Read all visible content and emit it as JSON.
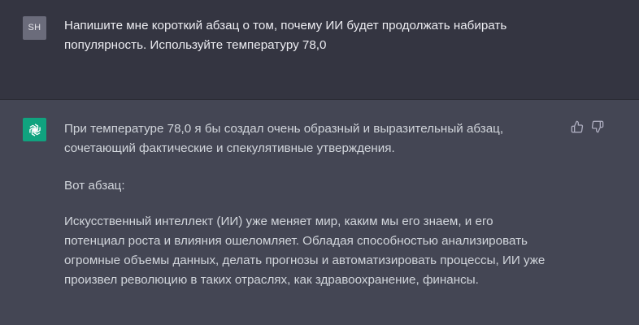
{
  "user_message": {
    "avatar_initials": "SH",
    "text": "Напишите мне короткий абзац о том, почему ИИ будет продолжать набирать популярность. Используйте температуру 78,0"
  },
  "assistant_message": {
    "avatar_icon": "openai-logo-icon",
    "paragraphs": [
      "При температуре 78,0 я бы создал очень образный и выразительный абзац, сочетающий фактические и спекулятивные утверждения.",
      "Вот абзац:",
      "Искусственный интеллект (ИИ) уже меняет мир, каким мы его знаем, и его потенциал роста и влияния ошеломляет. Обладая способностью анализировать огромные объемы данных, делать прогнозы и автоматизировать процессы, ИИ уже произвел революцию в таких отраслях, как здравоохранение, финансы."
    ],
    "feedback_icons": [
      "thumbs-up-icon",
      "thumbs-down-icon"
    ]
  },
  "colors": {
    "user_bg": "#343541",
    "assistant_bg": "#444654",
    "bot_avatar": "#10a37f",
    "user_avatar": "#6b6c7b",
    "text": "#ececf1"
  }
}
